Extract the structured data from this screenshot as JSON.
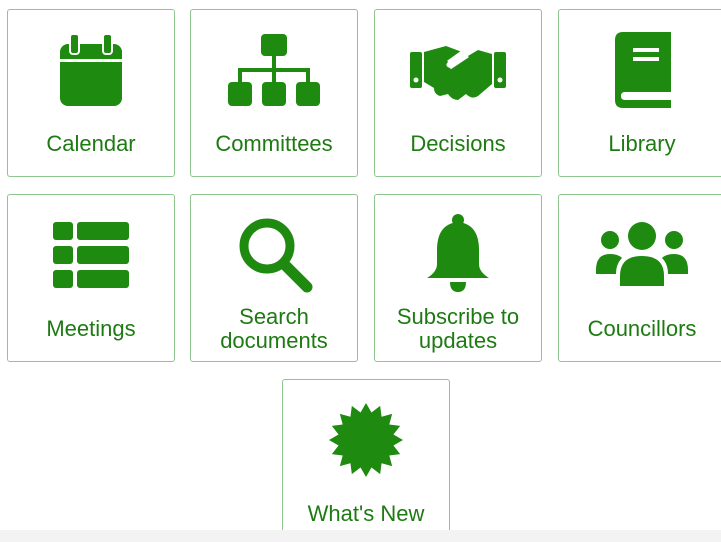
{
  "accent_color": "#1e8a10",
  "tiles": [
    {
      "label": "Calendar",
      "icon": "calendar-icon"
    },
    {
      "label": "Committees",
      "icon": "org-chart-icon"
    },
    {
      "label": "Decisions",
      "icon": "handshake-icon"
    },
    {
      "label": "Library",
      "icon": "book-icon"
    },
    {
      "label": "Meetings",
      "icon": "list-icon"
    },
    {
      "label": "Search\ndocuments",
      "icon": "search-icon"
    },
    {
      "label": "Subscribe to\nupdates",
      "icon": "bell-icon"
    },
    {
      "label": "Councillors",
      "icon": "users-icon"
    },
    {
      "label": "What's New",
      "icon": "starburst-icon"
    }
  ]
}
